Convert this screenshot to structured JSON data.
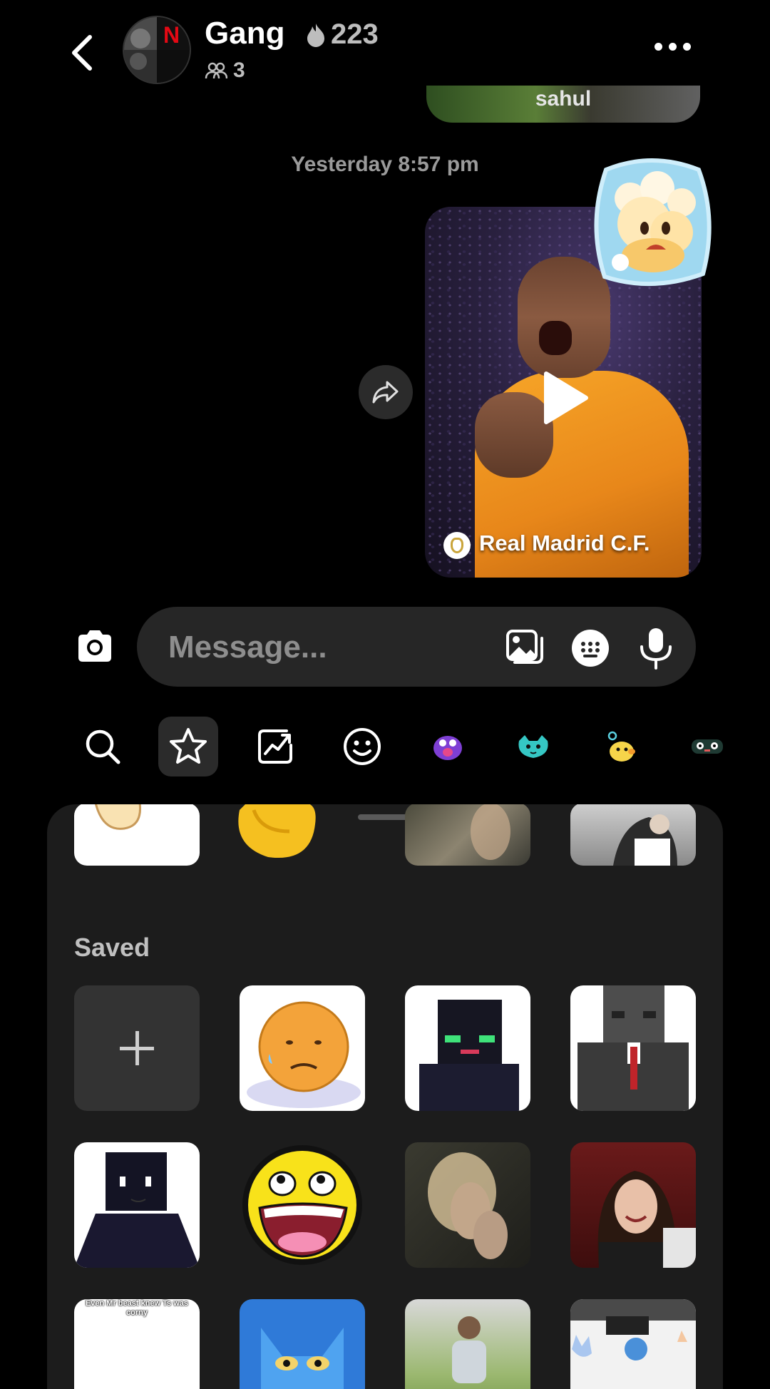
{
  "header": {
    "group_name": "Gang",
    "streak_count": "223",
    "member_count": "3",
    "back_icon": "chevron-left-icon",
    "more_icon": "ellipsis-icon"
  },
  "chat": {
    "previous_media_caption": "sahul",
    "timestamp": "Yesterday 8:57 pm",
    "video_message": {
      "channel_name": "Real Madrid C.F."
    }
  },
  "composer": {
    "placeholder": "Message..."
  },
  "sticker_tray": {
    "tabs": [
      "search-icon",
      "star-icon",
      "trending-icon",
      "emoji-icon",
      "sticker-pack-purple",
      "sticker-pack-teal",
      "sticker-pack-yellow",
      "sticker-pack-dark"
    ],
    "saved_label": "Saved",
    "meme_caption": "Even Mr beast knew Ts was corny"
  },
  "colors": {
    "background": "#000000",
    "bubble": "#262626",
    "panel": "#1c1c1c",
    "accent_orange": "#f7a628"
  }
}
